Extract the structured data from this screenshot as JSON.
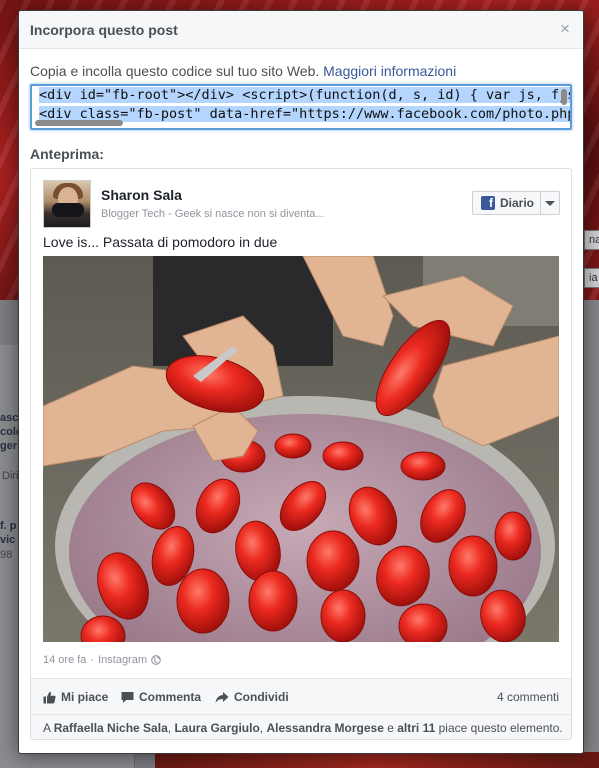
{
  "background": {
    "right_fragments": [
      "na",
      "ia"
    ],
    "left_fragments": [
      "asce",
      "colo",
      "ger",
      "Diri",
      "f. p",
      "vic",
      "98"
    ]
  },
  "dialog": {
    "title": "Incorpora questo post",
    "close_glyph": "×",
    "instructions": "Copia e incolla questo codice sul tuo sito Web.",
    "more_info_link": "Maggiori informazioni",
    "code_line_1": "<div id=\"fb-root\"></div> <script>(function(d, s, id) { var js, fjs = d.getElem",
    "code_line_2": "<div class=\"fb-post\" data-href=\"https://www.facebook.com/photo.php?fbid",
    "preview_label": "Anteprima:"
  },
  "post": {
    "author": "Sharon Sala",
    "tagline": "Blogger Tech - Geek si nasce non si diventa...",
    "follow_button": "Diario",
    "text": "Love is... Passata di pomodoro in due",
    "photo_icon": "tomatoes-photo",
    "time": "14 ore fa",
    "separator": "·",
    "source": "Instagram",
    "actions": {
      "like": "Mi piace",
      "comment": "Commenta",
      "share": "Condividi"
    },
    "comments_count": "4 commenti",
    "likes": {
      "prefix": "A",
      "name1": "Raffaella Niche Sala",
      "sep1": ",",
      "name2": "Laura Gargiulo",
      "sep2": ",",
      "name3": "Alessandra Morgese",
      "conj": "e",
      "others": "altri 11",
      "suffix": "piace questo elemento."
    }
  },
  "colors": {
    "link": "#365899",
    "facebook_blue": "#3b5998",
    "selection": "#b4d5fe",
    "focus_border": "#5b9dd9"
  }
}
